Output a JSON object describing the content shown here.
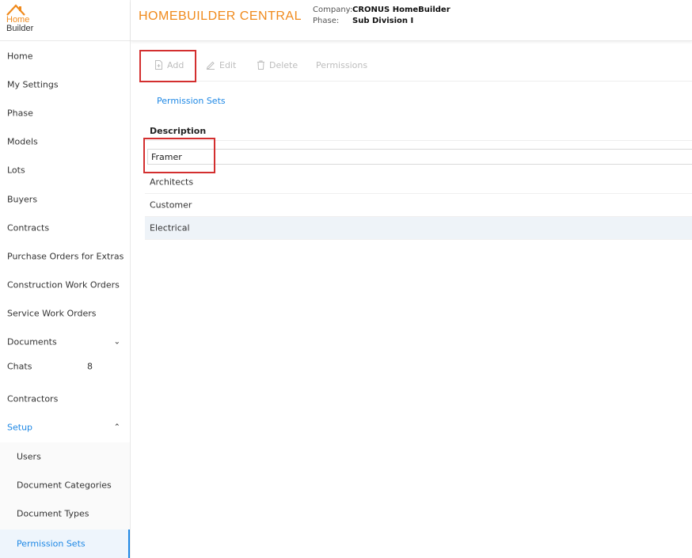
{
  "logo": {
    "line1": "Home",
    "line2": "Builder"
  },
  "header": {
    "title": "HOMEBUILDER CENTRAL",
    "company_label": "Company:",
    "company_value": "CRONUS HomeBuilder",
    "phase_label": "Phase:",
    "phase_value": "Sub Division I"
  },
  "sidebar": {
    "items": [
      {
        "label": "Home"
      },
      {
        "label": "My Settings"
      },
      {
        "label": "Phase"
      },
      {
        "label": "Models"
      },
      {
        "label": "Lots"
      },
      {
        "label": "Buyers"
      },
      {
        "label": "Contracts"
      },
      {
        "label": "Purchase Orders for Extras"
      },
      {
        "label": "Construction Work Orders"
      },
      {
        "label": "Service Work Orders"
      },
      {
        "label": "Documents",
        "chevron": "⌄"
      },
      {
        "label": "Chats",
        "badge": "8"
      },
      {
        "label": "Contractors"
      },
      {
        "label": "Setup",
        "chevron": "⌃"
      }
    ],
    "setup_children": [
      {
        "label": "Users"
      },
      {
        "label": "Document Categories"
      },
      {
        "label": "Document Types"
      },
      {
        "label": "Permission Sets"
      }
    ]
  },
  "toolbar": {
    "add_label": "Add",
    "edit_label": "Edit",
    "delete_label": "Delete",
    "permissions_label": "Permissions"
  },
  "tab": {
    "label": "Permission Sets"
  },
  "grid": {
    "header": "Description",
    "new_row_value": "Framer",
    "rows": [
      "Architects",
      "Customer",
      "Electrical"
    ]
  },
  "colors": {
    "brand_orange": "#f08a1c",
    "accent_blue": "#1e88e5",
    "highlight_red": "#d32f2f",
    "disabled_gray": "#bdbdbd"
  },
  "icons": {
    "logo": "house-roof-icon",
    "add": "file-add-icon",
    "edit": "pencil-icon",
    "delete": "trash-icon",
    "expand": "chevron-down-icon",
    "collapse": "chevron-up-icon"
  }
}
